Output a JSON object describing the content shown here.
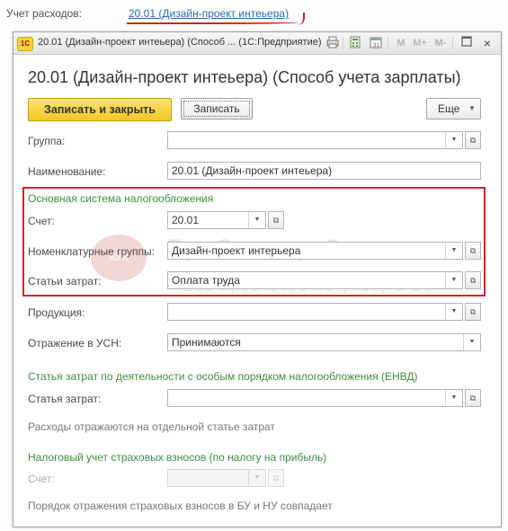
{
  "context": {
    "label": "Учет расходов:",
    "link": "20.01 (Дизайн-проект интеьера)"
  },
  "window": {
    "logo": "1С",
    "title": "20.01 (Дизайн-проект интеьера) (Способ ... (1С:Предприятие)",
    "toolbar_icons": [
      "print-icon",
      "calculator-icon",
      "calendar-icon",
      "m-icon",
      "m-plus-icon",
      "m-minus-icon",
      "maximize-icon",
      "close-icon"
    ],
    "toolbar_m": "M",
    "toolbar_m_plus": "M+",
    "toolbar_m_minus": "M-",
    "close_glyph": "×"
  },
  "form": {
    "title": "20.01 (Дизайн-проект интеьера) (Способ учета зарплаты)",
    "buttons": {
      "save_close": "Записать и закрыть",
      "save": "Записать",
      "more": "Еще"
    },
    "fields": {
      "group_label": "Группа:",
      "group_value": "",
      "name_label": "Наименование:",
      "name_value": "20.01 (Дизайн-проект интеьера)",
      "main_tax_section": "Основная система налогообложения",
      "account_label": "Счет:",
      "account_value": "20.01",
      "nomenclature_label": "Номенклатурные группы:",
      "nomenclature_value": "Дизайн-проект интерьера",
      "cost_items_label": "Статьи затрат:",
      "cost_items_value": "Оплата труда",
      "product_label": "Продукция:",
      "product_value": "",
      "usn_label": "Отражение в УСН:",
      "usn_value": "Принимаются",
      "envd_section": "Статья затрат по деятельности с особым порядком налогообложения (ЕНВД)",
      "envd_cost_label": "Статья затрат:",
      "envd_cost_value": "",
      "envd_info": "Расходы отражаются на отдельной статье затрат",
      "insurance_section": "Налоговый учет страховых взносов (по налогу на прибыль)",
      "insurance_account_label": "Счет:",
      "insurance_account_value": "",
      "insurance_info": "Порядок отражения страховых взносов в БУ и НУ совпадает"
    }
  },
  "watermark": {
    "logo": "БУХ",
    "main": "БухЭксперт8",
    "sub": "Баз просчетов по учету в 1С"
  },
  "colors": {
    "primary_button": "#f3cb2c",
    "section_heading": "#3e8c3e",
    "highlight_border": "#c9262c",
    "link": "#2a6ab3"
  }
}
